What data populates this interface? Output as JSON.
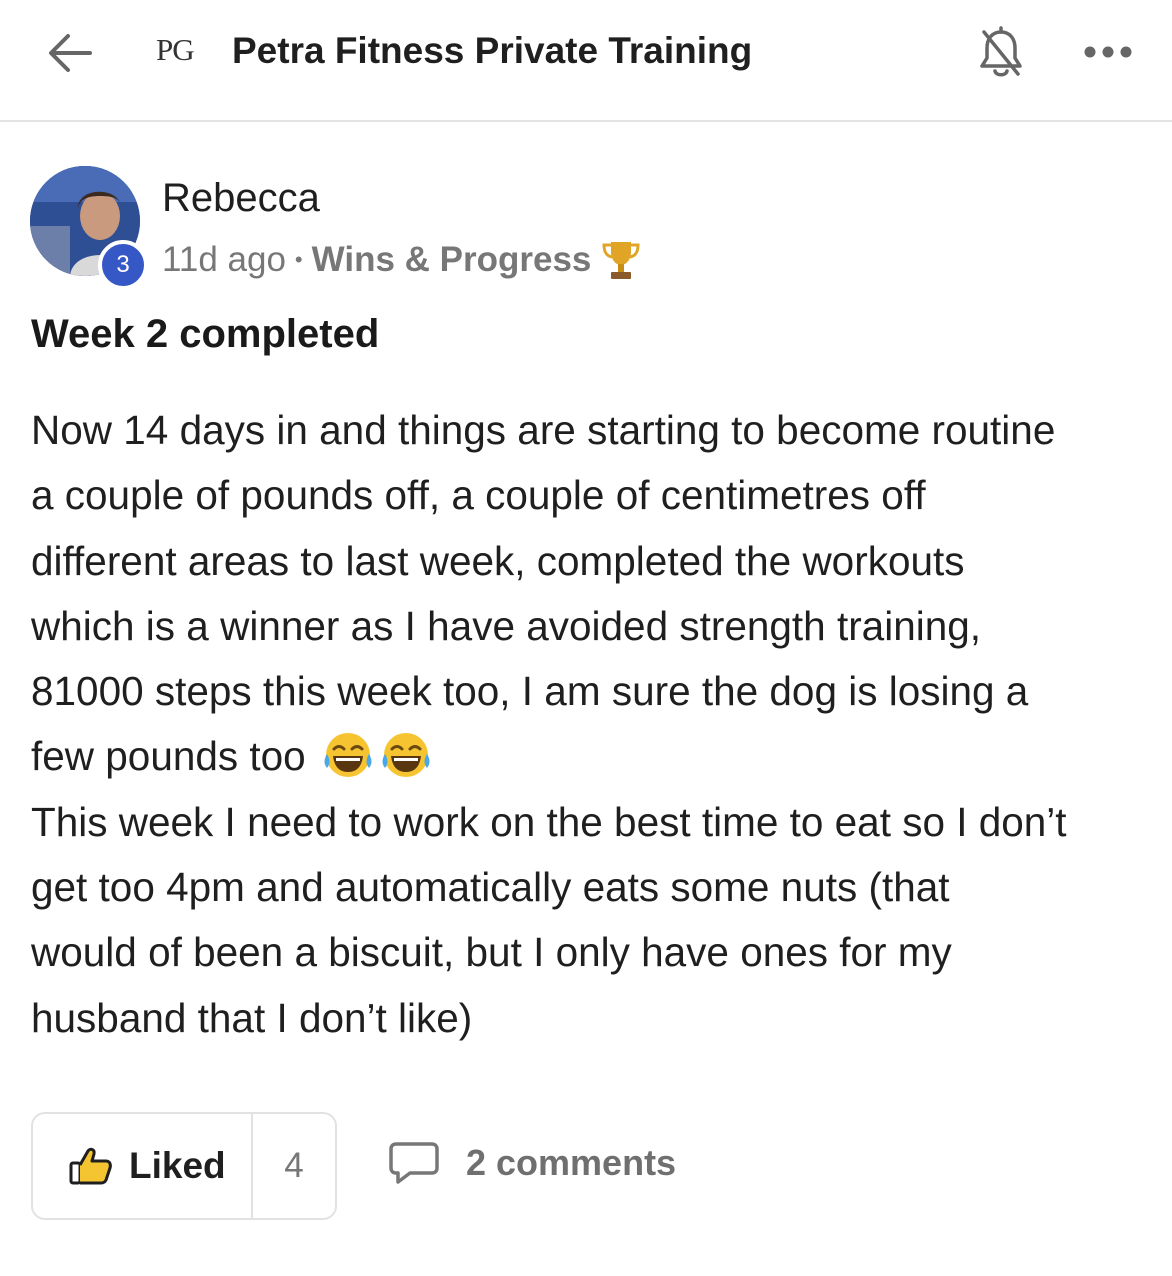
{
  "header": {
    "back_icon": "arrow-left-icon",
    "logo_text": "PG",
    "group_name": "Petra Fitness Private Training",
    "bell_icon": "bell-off-icon",
    "more_icon": "more-horizontal-icon"
  },
  "post": {
    "author": {
      "name": "Rebecca",
      "level": "3",
      "avatar_icon": "user-avatar"
    },
    "time": "11d ago",
    "separator": "•",
    "category": "Wins & Progress",
    "category_icon": "trophy-icon",
    "title": "Week 2 completed",
    "body_lines": [
      "Now 14 days in and things are starting to become routine",
      "a couple of pounds off, a couple of centimetres off",
      "different areas to last week, completed the workouts",
      "which is a winner as I have avoided strength training,",
      "81000 steps this week too, I am sure the dog is losing a",
      "few pounds too",
      "This week I need to work on the best time to eat so I don’t",
      "get too 4pm and automatically eats some nuts (that",
      "would of been a biscuit, but I only have ones for my",
      "husband that I don’t like)"
    ],
    "emoji_icons": [
      "tears-of-joy-emoji",
      "tears-of-joy-emoji"
    ]
  },
  "actions": {
    "like_label": "Liked",
    "like_count": "4",
    "like_icon": "thumbs-up-icon",
    "comments_label": "2 comments",
    "comments_icon": "comment-icon"
  },
  "colors": {
    "badge": "#3658c7",
    "muted_text": "#777777",
    "divider": "#e3e3e3"
  }
}
